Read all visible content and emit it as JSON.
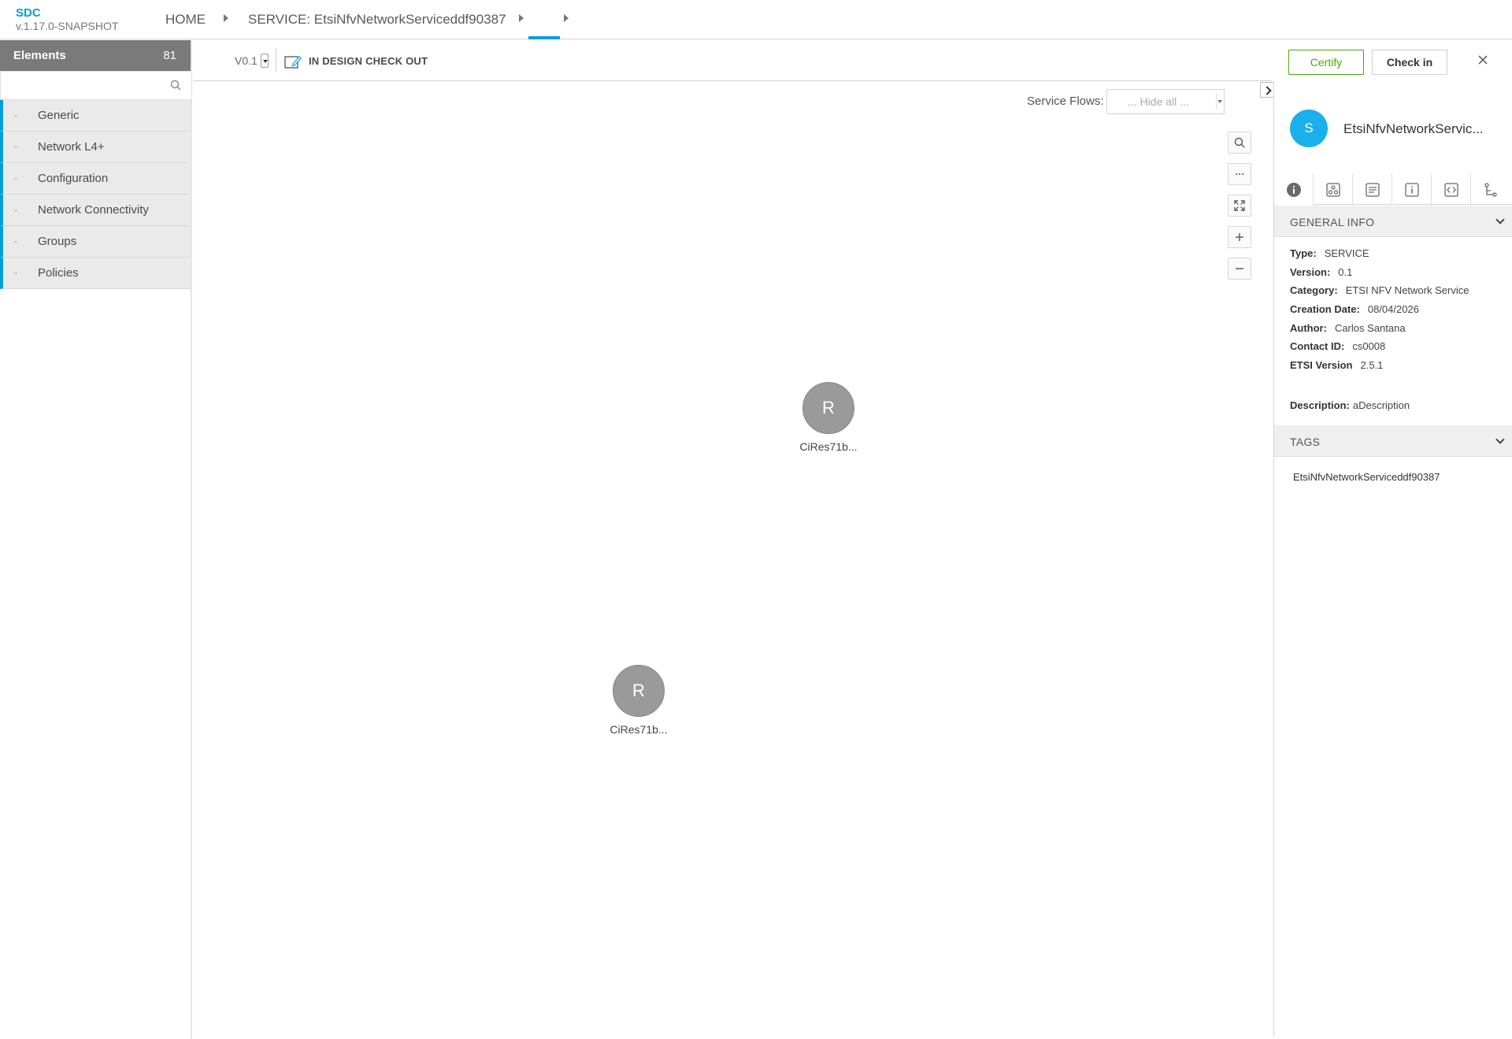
{
  "header": {
    "app_name": "SDC",
    "app_version": "v.1.17.0-SNAPSHOT",
    "breadcrumbs": [
      "HOME",
      "SERVICE: EtsiNfvNetworkServiceddf90387",
      ""
    ]
  },
  "palette": {
    "title": "Elements",
    "count": "81",
    "search_placeholder": "",
    "groups": [
      {
        "label": "Generic"
      },
      {
        "label": "Network L4+"
      },
      {
        "label": "Configuration"
      },
      {
        "label": "Network Connectivity"
      },
      {
        "label": "Groups"
      },
      {
        "label": "Policies"
      }
    ]
  },
  "toolbar": {
    "version": "V0.1",
    "status": "IN DESIGN CHECK OUT",
    "certify_label": "Certify",
    "checkin_label": "Check in"
  },
  "canvas": {
    "service_flows_label": "Service Flows:",
    "service_flows_value": "... Hide all ...",
    "nodes": [
      {
        "initial": "R",
        "label": "CiRes71b..."
      },
      {
        "initial": "R",
        "label": "CiRes71b..."
      }
    ]
  },
  "right_panel": {
    "avatar_initial": "S",
    "title": "EtsiNfvNetworkServic...",
    "general_info_title": "GENERAL INFO",
    "info": {
      "type_k": "Type:",
      "type_v": "SERVICE",
      "version_k": "Version:",
      "version_v": "0.1",
      "category_k": "Category:",
      "category_v": "ETSI NFV Network Service",
      "creation_k": "Creation Date:",
      "creation_v": "08/04/2026",
      "author_k": "Author:",
      "author_v": "Carlos Santana",
      "contact_k": "Contact ID:",
      "contact_v": "cs0008",
      "etsi_k": "ETSI Version",
      "etsi_v": "2.5.1",
      "desc_k": "Description:",
      "desc_v": "aDescription"
    },
    "tags_title": "TAGS",
    "tags": [
      "EtsiNfvNetworkServiceddf90387"
    ]
  },
  "colors": {
    "accent": "#009fdb",
    "certify": "#4ca90c",
    "avatar": "#1ab0ec",
    "node": "#9a9a9a"
  }
}
